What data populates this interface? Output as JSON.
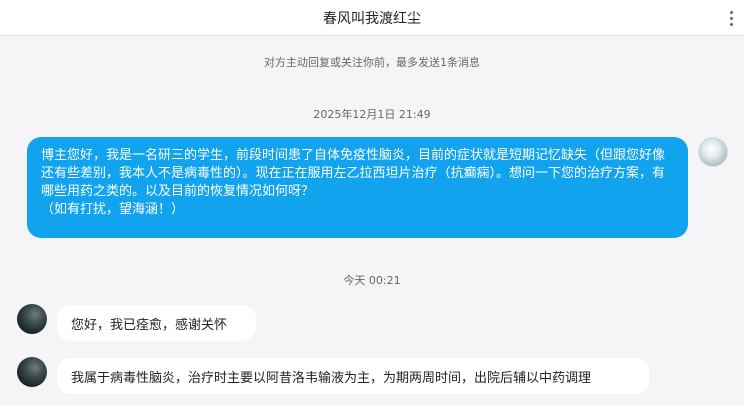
{
  "header": {
    "title": "春风叫我渡红尘",
    "more_icon": "vertical-ellipsis-icon"
  },
  "system_notice": "对方主动回复或关注你前，最多发送1条消息",
  "messages": [
    {
      "timestamp": "2025年12月1日 21:49",
      "from": "me",
      "text": "博主您好，我是一名研三的学生，前段时间患了自体免疫性脑炎，目前的症状就是短期记忆缺失（但跟您好像还有些差别，我本人不是病毒性的）。现在正在服用左乙拉西坦片治疗（抗癫痫）。想问一下您的治疗方案，有哪些用药之类的。以及目前的恢复情况如何呀？\n（如有打扰，望海涵！）"
    },
    {
      "timestamp": "今天 00:21",
      "from": "other",
      "text": "您好，我已痊愈，感谢关怀"
    },
    {
      "from": "other",
      "text": "我属于病毒性脑炎，治疗时主要以阿昔洛韦输液为主，为期两周时间，出院后辅以中药调理"
    }
  ],
  "colors": {
    "my_bubble": "#12a3ef",
    "other_bubble": "#ffffff",
    "background": "#f5f5f7"
  }
}
